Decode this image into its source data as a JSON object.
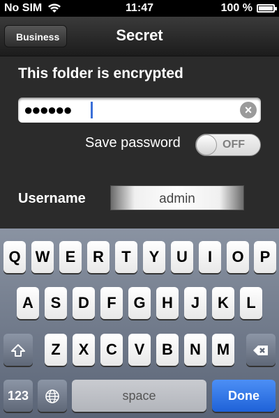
{
  "status_bar": {
    "carrier": "No SIM",
    "time": "11:47",
    "battery_text": "100 %"
  },
  "navbar": {
    "back_label": "Business",
    "title": "Secret"
  },
  "form": {
    "heading": "This folder is encrypted",
    "password_value": "●●●●●●",
    "save_password_label": "Save password",
    "save_password_state": "OFF",
    "username_label": "Username",
    "username_value": "admin"
  },
  "keyboard": {
    "row1": [
      "Q",
      "W",
      "E",
      "R",
      "T",
      "Y",
      "U",
      "I",
      "O",
      "P"
    ],
    "row2": [
      "A",
      "S",
      "D",
      "F",
      "G",
      "H",
      "J",
      "K",
      "L"
    ],
    "row3": [
      "Z",
      "X",
      "C",
      "V",
      "B",
      "N",
      "M"
    ],
    "numbers_label": "123",
    "space_label": "space",
    "done_label": "Done"
  }
}
